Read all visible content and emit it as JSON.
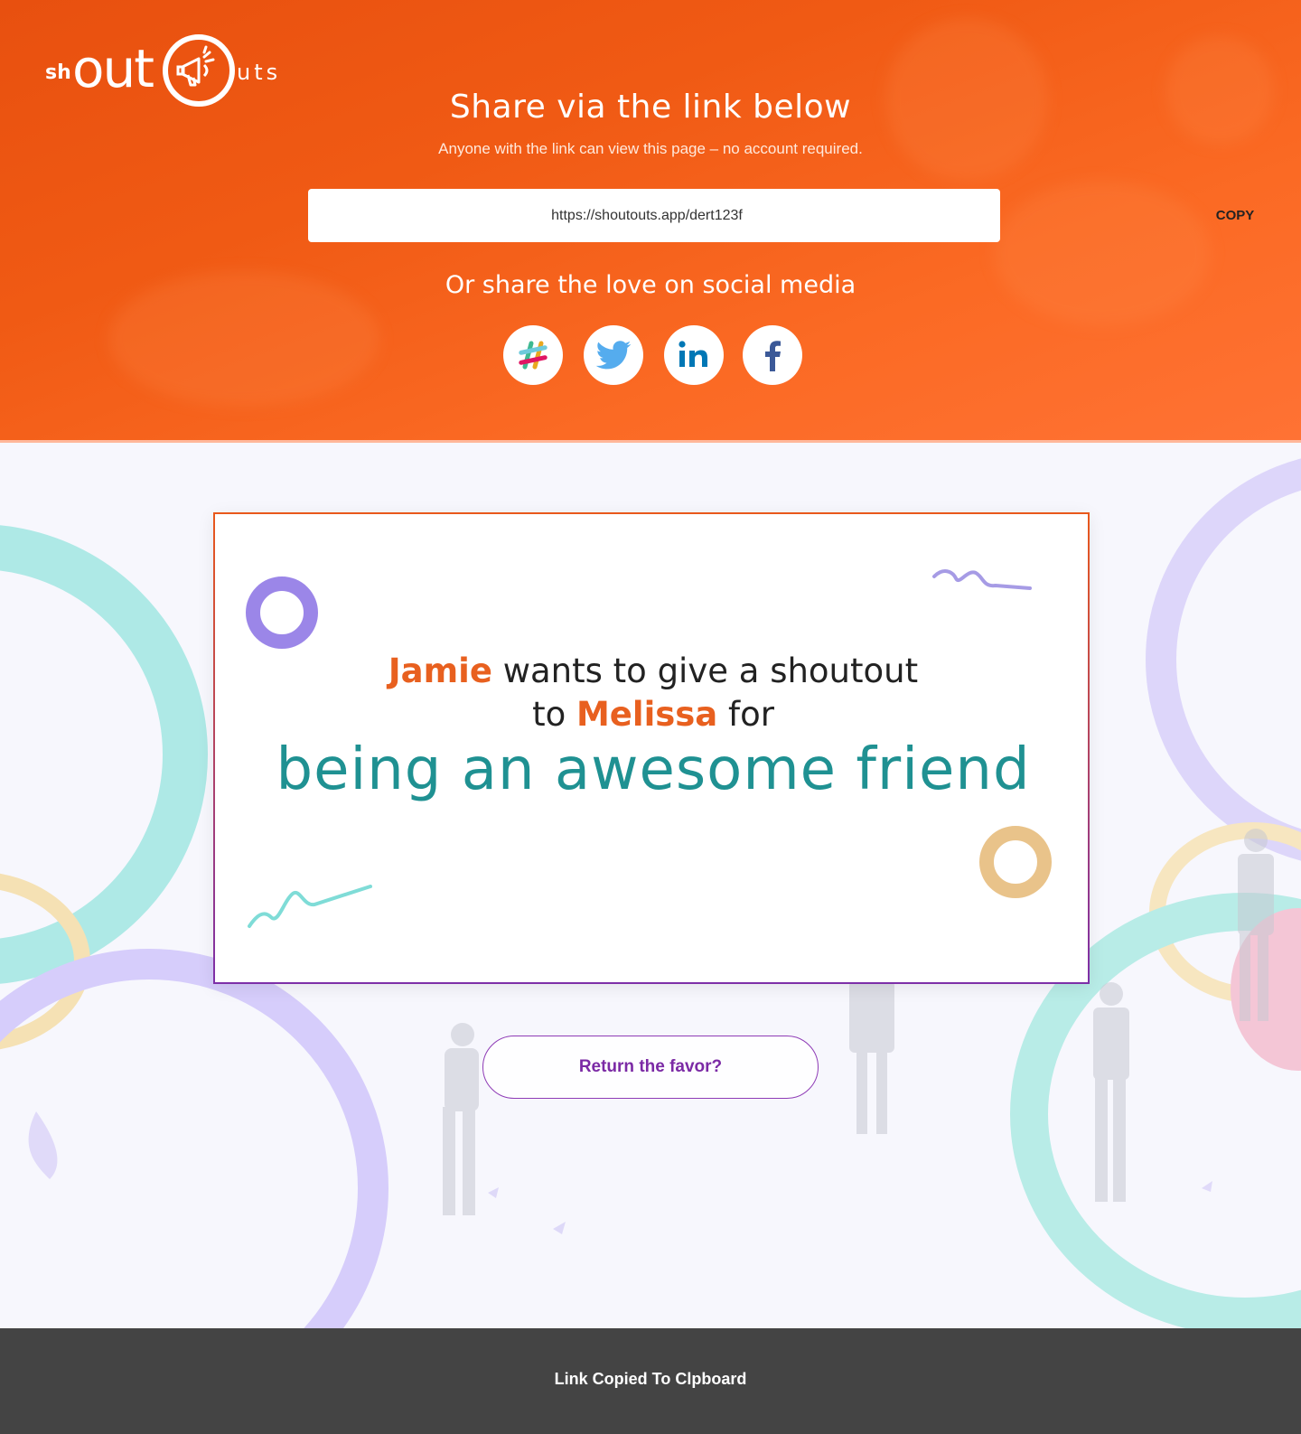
{
  "brand": {
    "logo_prefix": "sh",
    "logo_out": "out",
    "logo_suffix": "uts"
  },
  "share": {
    "title": "Share via the link below",
    "subtitle": "Anyone with the link can view this page – no account required.",
    "link_value": "https://shoutouts.app/dert123f",
    "copy_label": "COPY"
  },
  "social": {
    "title": "Or share the love on social media",
    "icons": [
      "slack-icon",
      "twitter-icon",
      "linkedin-icon",
      "facebook-icon"
    ]
  },
  "card": {
    "from_name": "Jamie",
    "line1_text": " wants to give a shoutout",
    "to_prefix": "to ",
    "to_name": "Melissa",
    "to_suffix": " for",
    "reason": "being an awesome friend"
  },
  "actions": {
    "return_favor": "Return the favor?"
  },
  "footer": {
    "toast": "Link Copied To Clpboard"
  },
  "colors": {
    "hero_orange": "#f05a14",
    "name_orange": "#e8601f",
    "reason_teal": "#1f9192",
    "accent_purple": "#7b2aa5",
    "footer_gray": "#444444"
  }
}
